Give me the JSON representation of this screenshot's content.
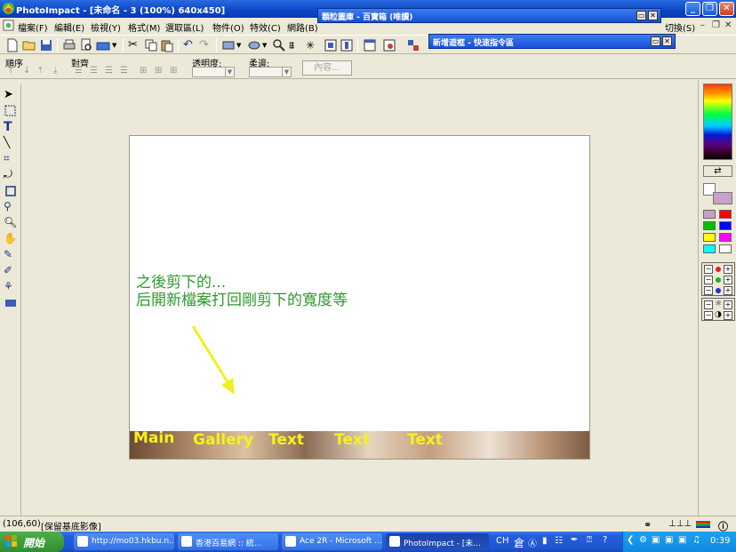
{
  "window": {
    "title": "PhotoImpact - [未命名 - 3 (100%) 640x450]"
  },
  "menu": {
    "items": [
      "檔案(F)",
      "編輯(E)",
      "檢視(Y)",
      "格式(M)",
      "選取區(L)",
      "物件(O)",
      "特效(C)",
      "網路(B)"
    ],
    "right_item": "切換(S)"
  },
  "floating_panels": [
    {
      "title": "顆粒圖庫 - 百寶箱 (唯讀)"
    },
    {
      "title": "新增遊框 - 快速指令區"
    }
  ],
  "attr_bar": {
    "order_label": "順序",
    "align_label": "對齊",
    "opacity_label": "透明度:",
    "feather_label": "柔邊:",
    "content_button": "內容..."
  },
  "canvas": {
    "line1": "之後剪下的...",
    "line2": "后開新檔案打回剛剪下的寬度等",
    "text_color": "#2d9a2d",
    "arrow_color": "#f0f020",
    "nav_labels": [
      "Main",
      "Gallery",
      "Text",
      "Text",
      "Text"
    ],
    "nav_color": "#f6f21a"
  },
  "colors": {
    "title_bar": "#0a45c6",
    "swatches": [
      "#c8a0c8",
      "#ff0000",
      "#00c000",
      "#0000ff",
      "#ffff00",
      "#ff00ff",
      "#00ffff",
      "#ffffff"
    ]
  },
  "statusbar": {
    "coords": "(106,60)",
    "hint": "[保留基底影像]"
  },
  "taskbar": {
    "start_label": "開始",
    "tasks": [
      "http://mo03.hkbu.n...",
      "香港百易網 :: 統...",
      "Ace 2R - Microsoft ...",
      "PhotoImpact - [未..."
    ],
    "ime": "CH",
    "time": "0:39"
  }
}
